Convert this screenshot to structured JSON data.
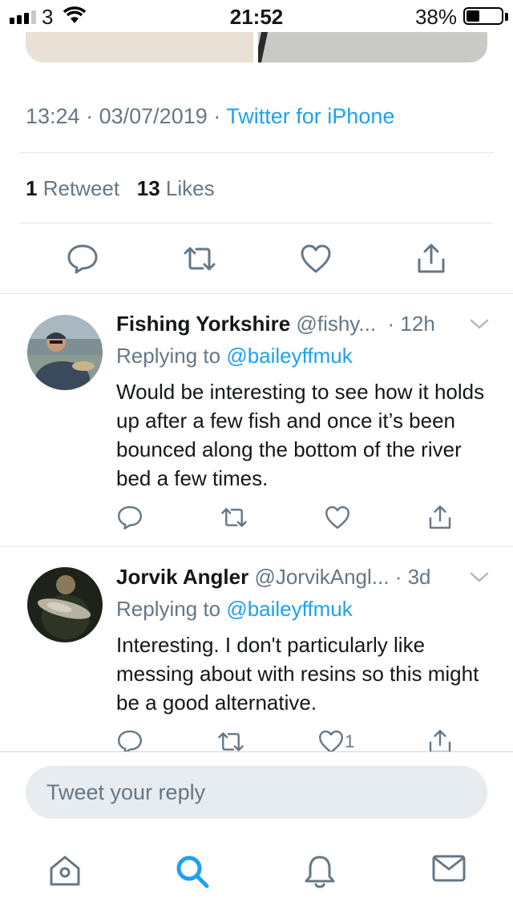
{
  "status_bar": {
    "carrier": "3",
    "time": "21:52",
    "battery_percent": "38%",
    "battery_level": 0.38
  },
  "tweet": {
    "time": "13:24",
    "date": "03/07/2019",
    "source": "Twitter for iPhone",
    "separator": "·",
    "retweet_count": "1",
    "retweet_label": "Retweet",
    "like_count": "13",
    "like_label": "Likes"
  },
  "replies": [
    {
      "name": "Fishing Yorkshire",
      "handle": "@fishy...",
      "age": "· 12h",
      "replying_prefix": "Replying to",
      "replying_to": "@baileyffmuk",
      "text": "Would be interesting to see how it holds up after a few fish and once it’s been bounced along the bottom of the river bed a few times.",
      "like_count": ""
    },
    {
      "name": "Jorvik Angler",
      "handle": "@JorvikAngl...",
      "age": "· 3d",
      "replying_prefix": "Replying to",
      "replying_to": "@baileyffmuk",
      "text": "Interesting. I don't particularly like messing about with resins so this might be a good alternative.",
      "like_count": "1"
    }
  ],
  "composer": {
    "placeholder": "Tweet your reply"
  },
  "colors": {
    "accent": "#1da1f2",
    "secondary_text": "#657786",
    "divider": "#e1e8ed"
  },
  "icons": {
    "tabbar": [
      "home-icon",
      "search-icon",
      "notifications-bell-icon",
      "messages-envelope-icon"
    ],
    "actions": [
      "reply-icon",
      "retweet-icon",
      "like-heart-icon",
      "share-icon"
    ]
  }
}
